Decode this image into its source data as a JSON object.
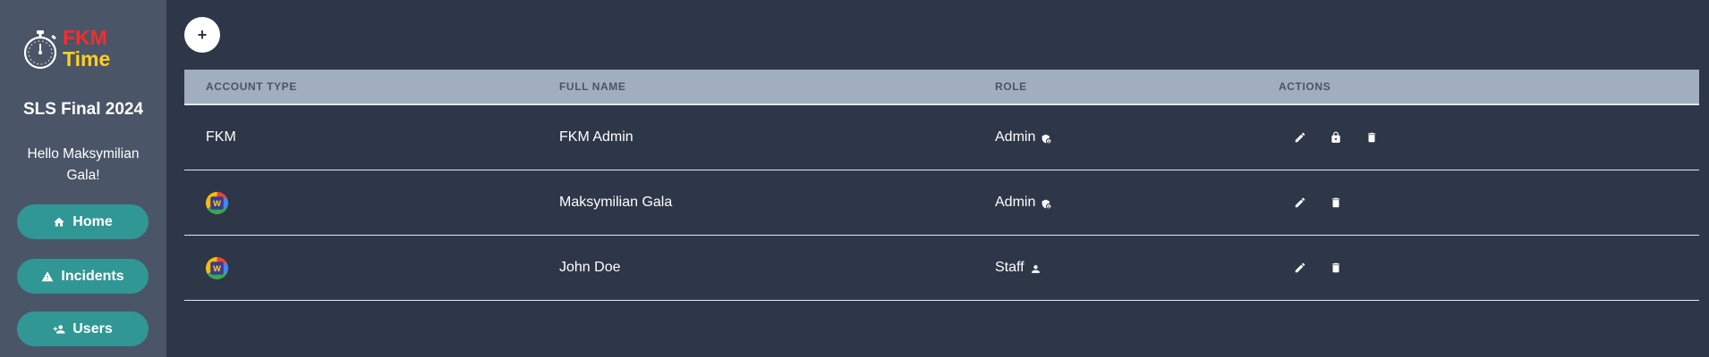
{
  "brand": {
    "line1": "FKM",
    "line2": "Time",
    "icon": "stopwatch-icon",
    "colors": {
      "fkm": "#ff2a2a",
      "time": "#ffd020"
    }
  },
  "sidebar": {
    "event_title": "SLS Final 2024",
    "greeting": "Hello Maksymilian Gala!",
    "nav": [
      {
        "label": "Home",
        "icon": "home-icon"
      },
      {
        "label": "Incidents",
        "icon": "warning-icon"
      },
      {
        "label": "Users",
        "icon": "user-add-icon"
      }
    ]
  },
  "toolbar": {
    "add_label": "+"
  },
  "table": {
    "headers": {
      "account_type": "ACCOUNT TYPE",
      "full_name": "FULL NAME",
      "role": "ROLE",
      "actions": "ACTIONS"
    },
    "rows": [
      {
        "account_type": "FKM",
        "account_icon": "",
        "full_name": "FKM Admin",
        "role": "Admin",
        "role_icon": "admin-shield-icon",
        "actions": [
          "edit-icon",
          "lock-icon",
          "delete-icon"
        ]
      },
      {
        "account_type": "",
        "account_icon": "provider-logo-icon",
        "full_name": "Maksymilian Gala",
        "role": "Admin",
        "role_icon": "admin-shield-icon",
        "actions": [
          "edit-icon",
          "delete-icon"
        ]
      },
      {
        "account_type": "",
        "account_icon": "provider-logo-icon",
        "full_name": "John Doe",
        "role": "Staff",
        "role_icon": "person-icon",
        "actions": [
          "edit-icon",
          "delete-icon"
        ]
      }
    ]
  },
  "theme": {
    "background": "#2e3748",
    "sidebar": "#4a5568",
    "accent": "#319795",
    "header_bg": "#a0aec0"
  }
}
